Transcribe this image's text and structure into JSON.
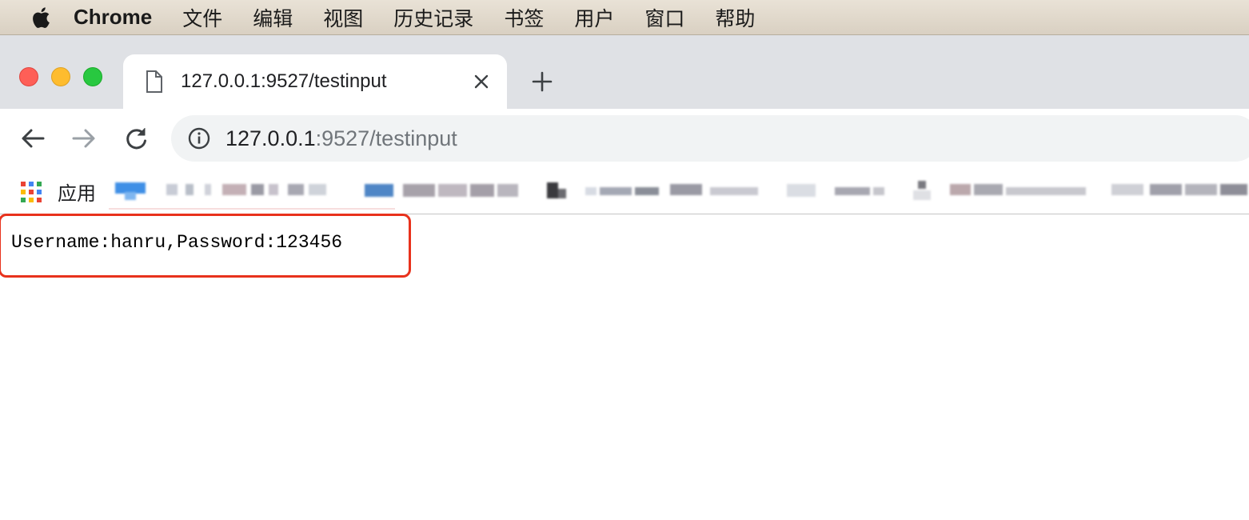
{
  "menubar": {
    "app_name": "Chrome",
    "items": [
      "文件",
      "编辑",
      "视图",
      "历史记录",
      "书签",
      "用户",
      "窗口",
      "帮助"
    ]
  },
  "tab": {
    "title": "127.0.0.1:9527/testinput",
    "icon": "page-icon"
  },
  "omnibox": {
    "url_host": "127.0.0.1",
    "url_rest": ":9527/testinput",
    "icon": "info-icon"
  },
  "bookmarks": {
    "apps_label": "应用",
    "apps_colors": [
      "#ea4335",
      "#4285f4",
      "#34a853",
      "#fbbc05",
      "#ea4335",
      "#4285f4",
      "#34a853",
      "#fbbc05",
      "#ea4335"
    ]
  },
  "content": {
    "text": "Username:hanru,Password:123456",
    "highlight_color": "#e8321c"
  },
  "colors": {
    "tabstrip": "#dfe1e5",
    "omnibox": "#f1f3f4"
  }
}
